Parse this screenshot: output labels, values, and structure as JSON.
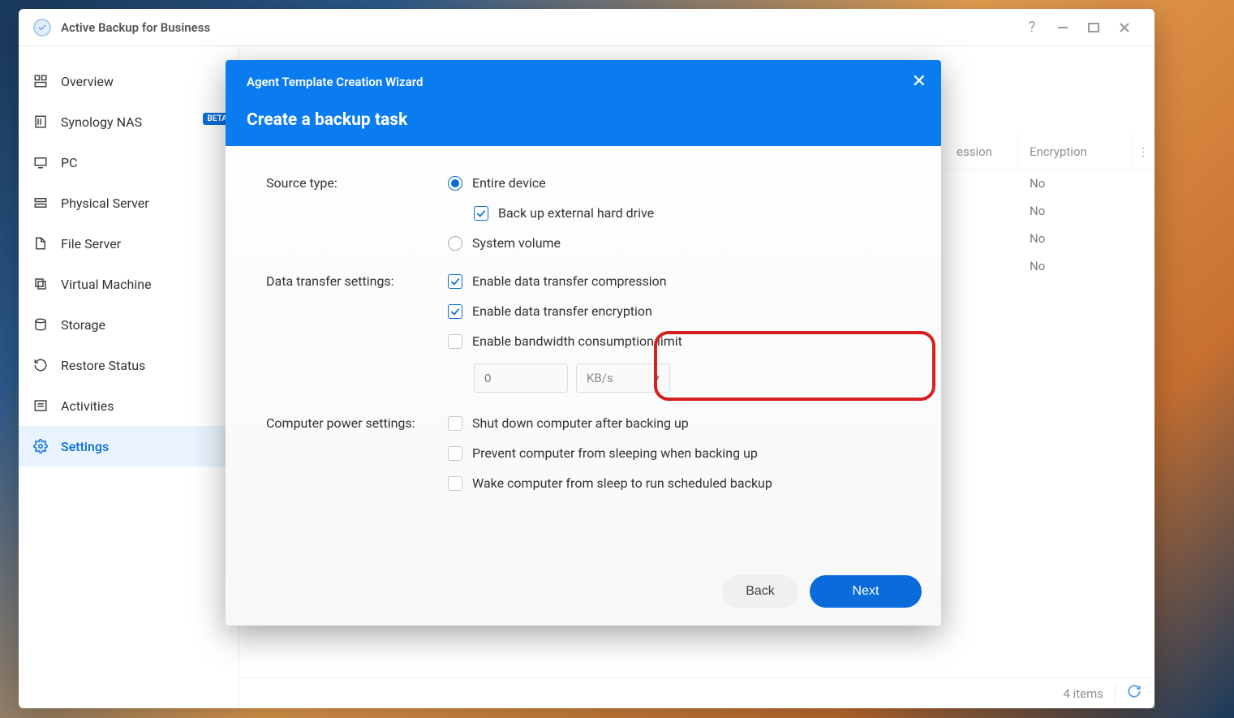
{
  "titlebar": {
    "app_title": "Active Backup for Business",
    "help": "?"
  },
  "sidebar": {
    "items": [
      {
        "label": "Overview"
      },
      {
        "label": "Synology NAS",
        "badge": "BETA"
      },
      {
        "label": "PC"
      },
      {
        "label": "Physical Server"
      },
      {
        "label": "File Server"
      },
      {
        "label": "Virtual Machine"
      },
      {
        "label": "Storage"
      },
      {
        "label": "Restore Status"
      },
      {
        "label": "Activities"
      },
      {
        "label": "Settings"
      }
    ]
  },
  "table": {
    "col_compression_partial": "ession",
    "col_encryption": "Encryption",
    "rows": [
      {
        "encryption": "No"
      },
      {
        "encryption": "No"
      },
      {
        "encryption": "No"
      },
      {
        "encryption": "No"
      }
    ]
  },
  "statusbar": {
    "count_label": "4 items"
  },
  "modal": {
    "wizard_title": "Agent Template Creation Wizard",
    "heading": "Create a backup task",
    "labels": {
      "source_type": "Source type:",
      "data_transfer": "Data transfer settings:",
      "power": "Computer power settings:"
    },
    "options": {
      "entire_device": "Entire device",
      "backup_external": "Back up external hard drive",
      "system_volume": "System volume",
      "compression": "Enable data transfer compression",
      "encryption": "Enable data transfer encryption",
      "bandwidth": "Enable bandwidth consumption limit",
      "bw_value": "0",
      "bw_unit": "KB/s",
      "shutdown": "Shut down computer after backing up",
      "prevent_sleep": "Prevent computer from sleeping when backing up",
      "wake": "Wake computer from sleep to run scheduled backup"
    },
    "buttons": {
      "back": "Back",
      "next": "Next"
    }
  }
}
